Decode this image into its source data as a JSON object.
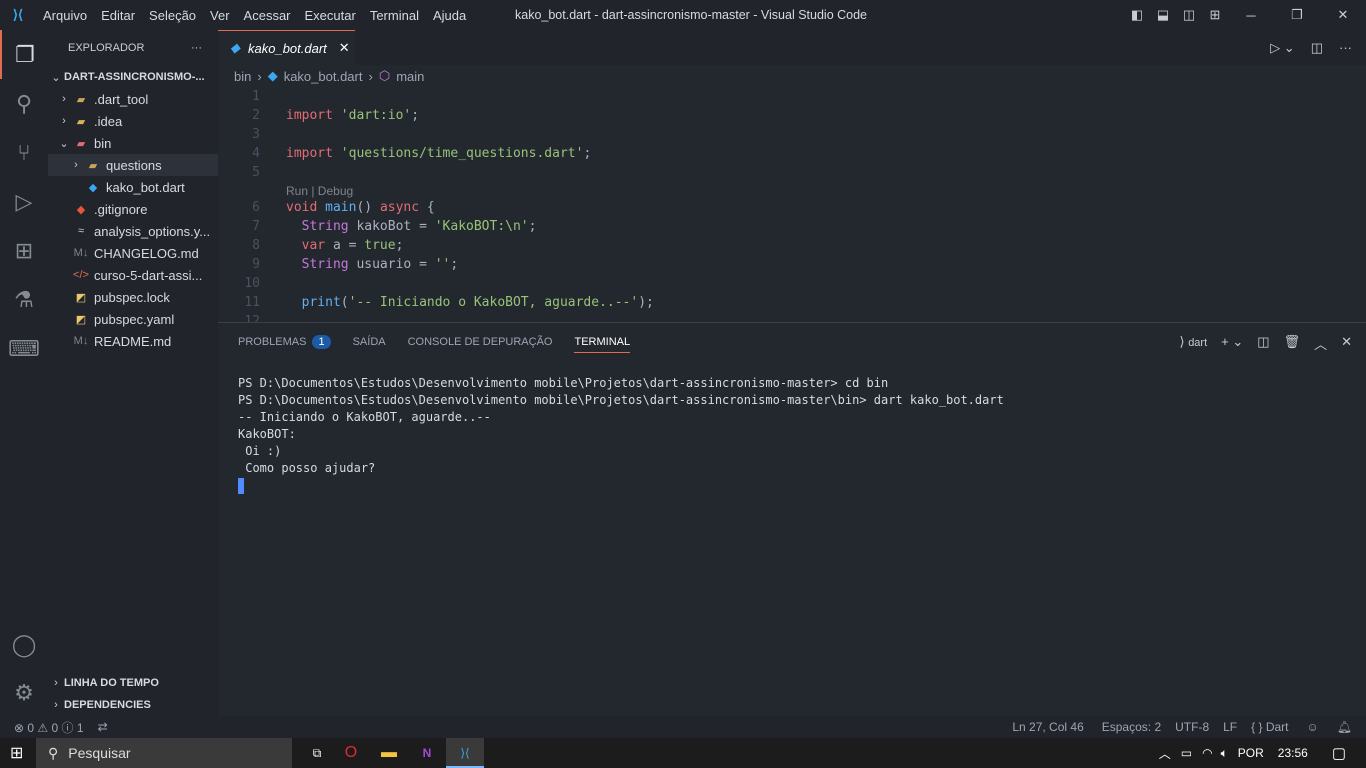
{
  "window": {
    "title": "kako_bot.dart - dart-assincronismo-master - Visual Studio Code",
    "menu": [
      "Arquivo",
      "Editar",
      "Seleção",
      "Ver",
      "Acessar",
      "Executar",
      "Terminal",
      "Ajuda"
    ]
  },
  "sidebar": {
    "title": "EXPLORADOR",
    "more": "···",
    "root": "DART-ASSINCRONISMO-...",
    "items": [
      {
        "label": ".dart_tool",
        "icon": "folder-icon",
        "indent": 1,
        "chev": "›"
      },
      {
        "label": ".idea",
        "icon": "folder-idea-icon",
        "indent": 1,
        "chev": "›"
      },
      {
        "label": "bin",
        "icon": "folder-bin-icon",
        "indent": 1,
        "chev": "⌄"
      },
      {
        "label": "questions",
        "icon": "folder-icon",
        "indent": 2,
        "chev": "›"
      },
      {
        "label": "kako_bot.dart",
        "icon": "dart-icon",
        "indent": 2,
        "chev": ""
      },
      {
        "label": ".gitignore",
        "icon": "git-icon",
        "indent": 1,
        "chev": ""
      },
      {
        "label": "analysis_options.y...",
        "icon": "yaml-icon",
        "indent": 1,
        "chev": ""
      },
      {
        "label": "CHANGELOG.md",
        "icon": "markdown-icon",
        "indent": 1,
        "chev": ""
      },
      {
        "label": "curso-5-dart-assi...",
        "icon": "html-icon",
        "indent": 1,
        "chev": ""
      },
      {
        "label": "pubspec.lock",
        "icon": "flutter-icon",
        "indent": 1,
        "chev": ""
      },
      {
        "label": "pubspec.yaml",
        "icon": "flutter-icon",
        "indent": 1,
        "chev": ""
      },
      {
        "label": "README.md",
        "icon": "markdown-icon",
        "indent": 1,
        "chev": ""
      }
    ],
    "timeline": "LINHA DO TEMPO",
    "dependencies": "DEPENDENCIES"
  },
  "editor": {
    "tab": "kako_bot.dart",
    "breadcrumb": [
      "bin",
      "kako_bot.dart",
      "main"
    ],
    "codelens": "Run | Debug"
  },
  "panel": {
    "tabs": [
      "PROBLEMAS",
      "SAÍDA",
      "CONSOLE DE DEPURAÇÃO",
      "TERMINAL"
    ],
    "problems_count": "1",
    "shell": "dart",
    "terminal": [
      "PS D:\\Documentos\\Estudos\\Desenvolvimento mobile\\Projetos\\dart-assincronismo-master> cd bin",
      "PS D:\\Documentos\\Estudos\\Desenvolvimento mobile\\Projetos\\dart-assincronismo-master\\bin> dart kako_bot.dart",
      "-- Iniciando o KakoBOT, aguarde..--",
      "KakoBOT:",
      " Oi :)",
      " Como posso ajudar?"
    ]
  },
  "status": {
    "errors": "0",
    "warnings": "0",
    "info": "1",
    "position": "Ln 27, Col 46",
    "spaces": "Espaços: 2",
    "encoding": "UTF-8",
    "eol": "LF",
    "language": "Dart"
  },
  "taskbar": {
    "search": "Pesquisar",
    "lang": "POR",
    "time": "23:56"
  }
}
